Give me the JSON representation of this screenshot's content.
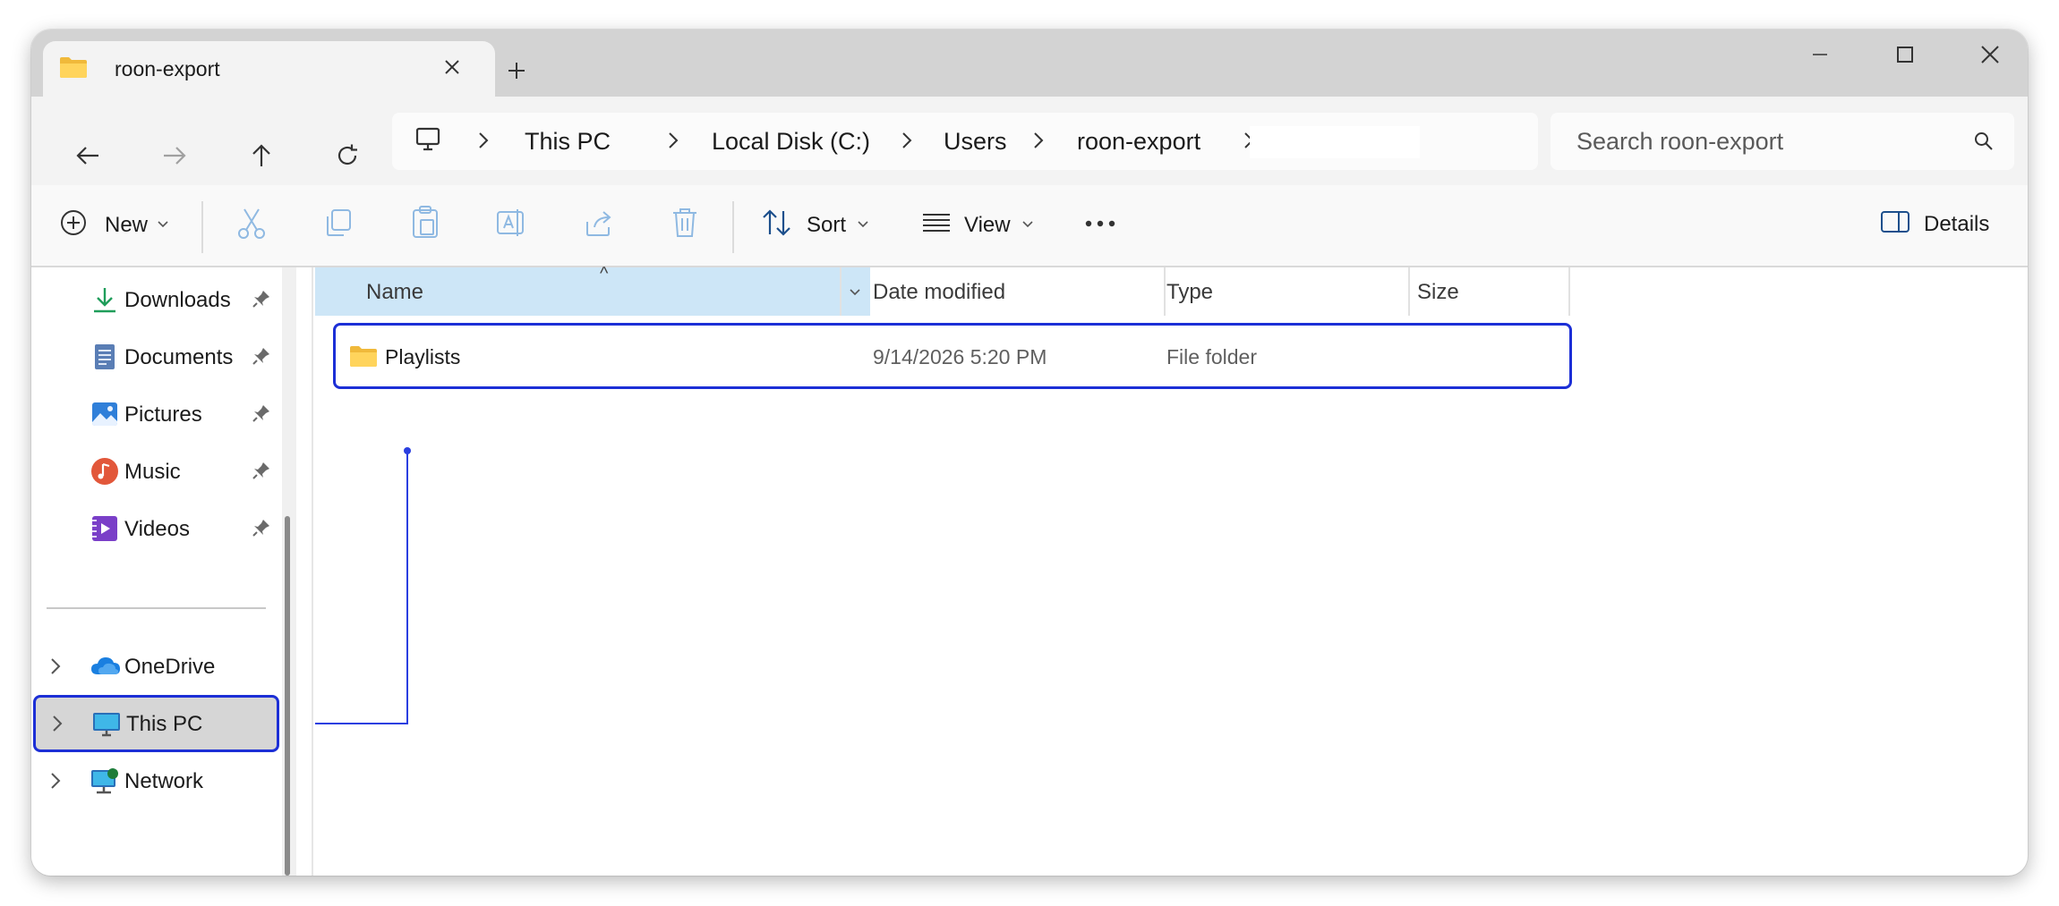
{
  "window": {
    "tab_title": "roon-export",
    "new_tab": "+"
  },
  "nav": {
    "breadcrumbs": [
      "This PC",
      "Local Disk (C:)",
      "Users",
      "roon-export"
    ],
    "search_placeholder": "Search roon-export"
  },
  "command_bar": {
    "new_label": "New",
    "sort_label": "Sort",
    "view_label": "View",
    "more_label": "•••",
    "details_label": "Details"
  },
  "sidebar": {
    "quick_access": [
      {
        "label": "Downloads",
        "icon": "download-icon",
        "pinned": true
      },
      {
        "label": "Documents",
        "icon": "documents-icon",
        "pinned": true
      },
      {
        "label": "Pictures",
        "icon": "pictures-icon",
        "pinned": true
      },
      {
        "label": "Music",
        "icon": "music-icon",
        "pinned": true
      },
      {
        "label": "Videos",
        "icon": "videos-icon",
        "pinned": true
      }
    ],
    "locations": [
      {
        "label": "OneDrive",
        "icon": "onedrive-icon"
      },
      {
        "label": "This PC",
        "icon": "this-pc-icon",
        "highlighted": true
      },
      {
        "label": "Network",
        "icon": "network-icon"
      }
    ]
  },
  "file_list": {
    "columns": [
      "Name",
      "Date modified",
      "Type",
      "Size"
    ],
    "sort_indicator": "^",
    "rows": [
      {
        "name": "Playlists",
        "date_modified": "9/14/2026 5:20 PM",
        "type": "File folder",
        "size": ""
      }
    ]
  },
  "colors": {
    "annotation": "#1c2fd6",
    "selected_column": "#cde6f7",
    "folder": "#f7c948"
  }
}
